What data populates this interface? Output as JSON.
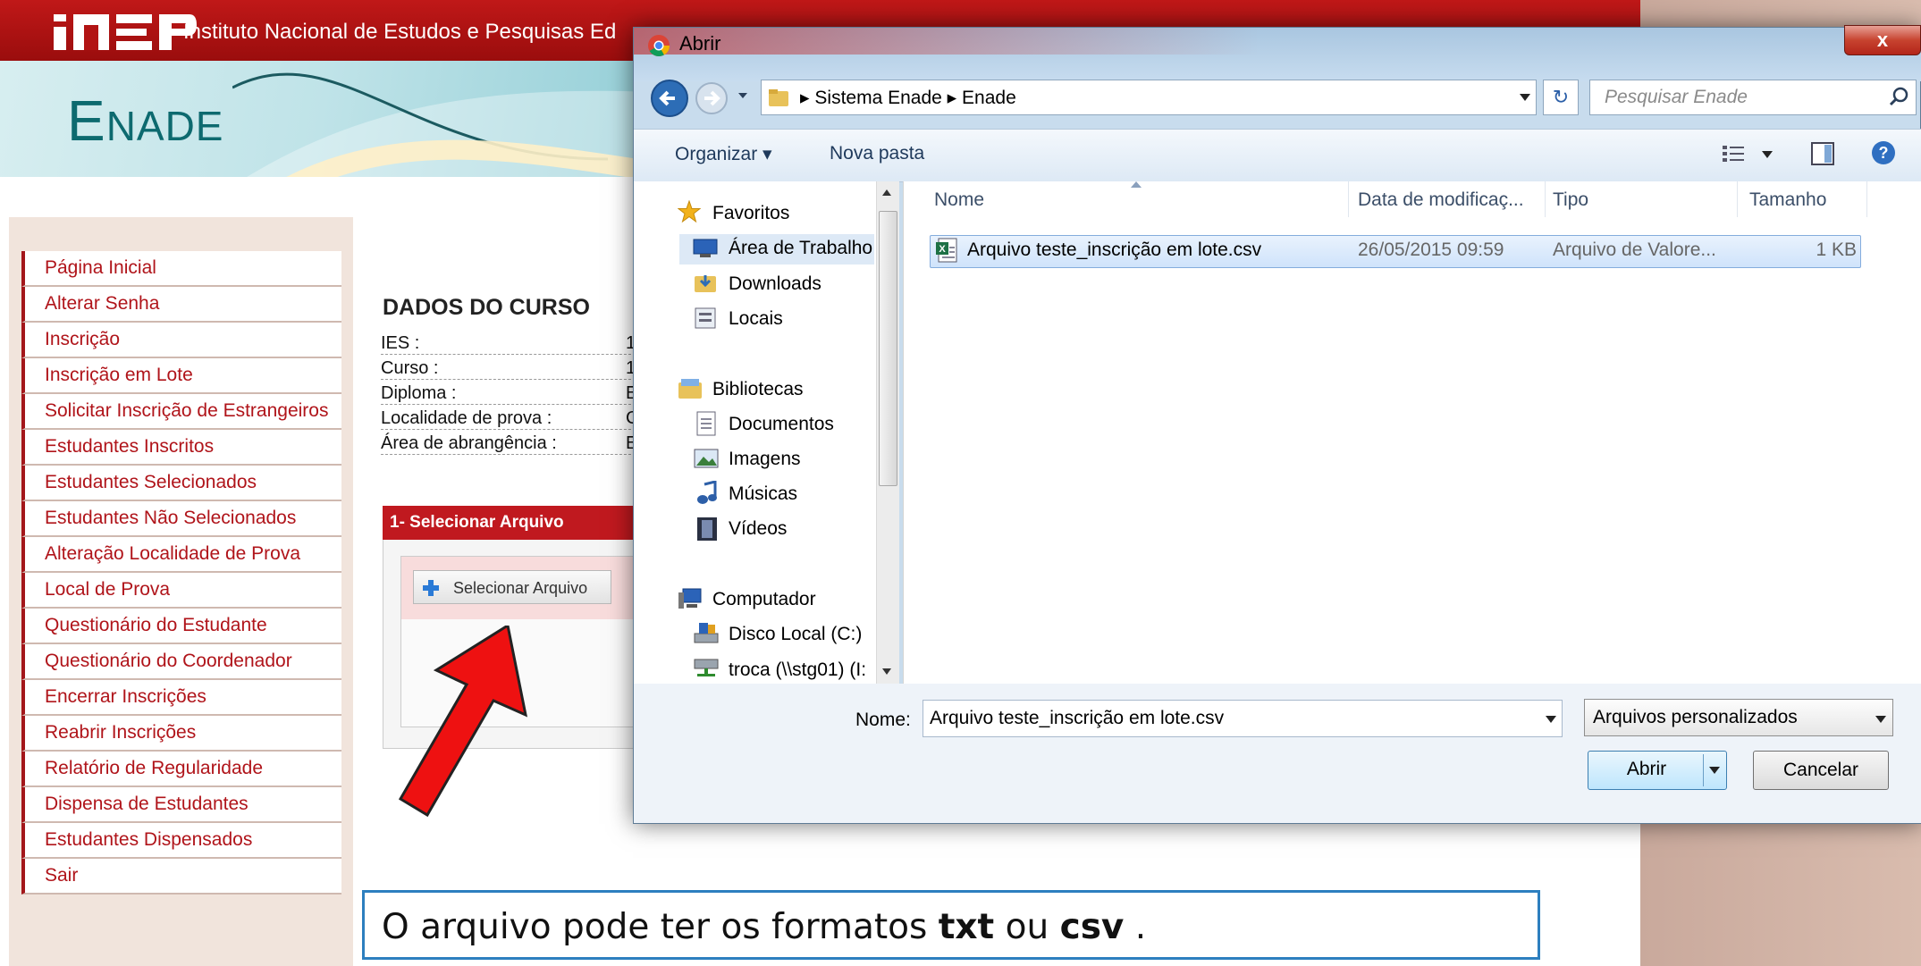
{
  "page": {
    "org_name": "Instituto Nacional de Estudos e Pesquisas Ed",
    "logo_text": "INEP",
    "enade_big": "E",
    "enade_rest": "NADE",
    "menu": [
      "Página Inicial",
      "Alterar Senha",
      "Inscrição",
      "Inscrição em Lote",
      "Solicitar Inscrição de Estrangeiros",
      "Estudantes Inscritos",
      "Estudantes Selecionados",
      "Estudantes Não Selecionados",
      "Alteração Localidade de Prova",
      "Local de Prova",
      "Questionário do Estudante",
      "Questionário do Coordenador",
      "Encerrar Inscrições",
      "Reabrir Inscrições",
      "Relatório de Regularidade",
      "Dispensa de Estudantes",
      "Estudantes Dispensados",
      "Sair"
    ],
    "course_heading": "DADOS DO CURSO",
    "course_fields": [
      {
        "label": "IES :",
        "value": "1"
      },
      {
        "label": "Curso :",
        "value": "1"
      },
      {
        "label": "Diploma :",
        "value": "E"
      },
      {
        "label": "Localidade de prova :",
        "value": "C"
      },
      {
        "label": "Área de abrangência :",
        "value": "E"
      }
    ],
    "step_header": "1- Selecionar Arquivo",
    "select_button": "Selecionar Arquivo"
  },
  "note": {
    "prefix": "O arquivo pode ter os formatos ",
    "fmt1": "txt",
    "mid": " ou ",
    "fmt2": "csv",
    "suffix": " ."
  },
  "dialog": {
    "title": "Abrir",
    "close_label": "x",
    "breadcrumb": [
      "Sistema Enade",
      "Enade"
    ],
    "search_placeholder": "Pesquisar Enade",
    "toolbar": {
      "organize": "Organizar ▾",
      "new_folder": "Nova pasta"
    },
    "nav": {
      "favorites": "Favoritos",
      "desktop": "Área de Trabalho",
      "downloads": "Downloads",
      "places": "Locais",
      "libraries": "Bibliotecas",
      "documents": "Documentos",
      "pictures": "Imagens",
      "music": "Músicas",
      "videos": "Vídeos",
      "computer": "Computador",
      "local_disk": "Disco Local (C:)",
      "network": "troca (\\\\stg01) (I:"
    },
    "columns": {
      "name": "Nome",
      "modified": "Data de modificaç...",
      "type": "Tipo",
      "size": "Tamanho"
    },
    "files": [
      {
        "name": "Arquivo teste_inscrição em lote.csv",
        "modified": "26/05/2015 09:59",
        "type": "Arquivo de Valore...",
        "size": "1 KB"
      }
    ],
    "filename_label": "Nome:",
    "filename_value": "Arquivo teste_inscrição em lote.csv",
    "filter_value": "Arquivos personalizados",
    "open_label": "Abrir",
    "cancel_label": "Cancelar"
  },
  "colors": {
    "inep_red": "#c0191f",
    "enade_teal": "#0d6a6f",
    "note_border": "#2d7fbf",
    "arrow_red": "#ee1111"
  }
}
